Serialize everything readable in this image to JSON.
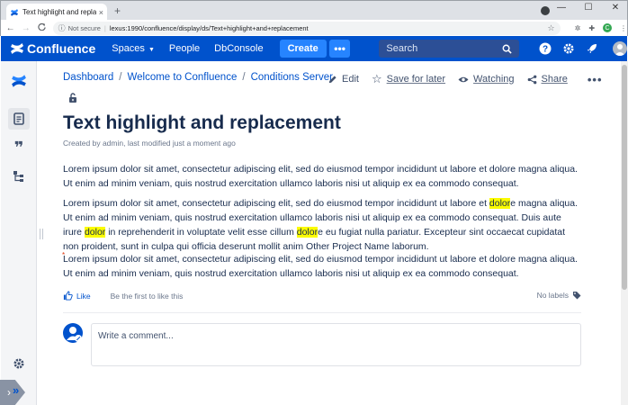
{
  "browser": {
    "tab_title": "Text highlight and replacement",
    "tab_close": "×",
    "new_tab": "+",
    "back": "←",
    "forward": "→",
    "reload": "C",
    "security": "Not secure",
    "url": "lexus:1990/confluence/display/ds/Text+highlight+and+replacement",
    "minimize": "—",
    "maximize": "☐",
    "close": "✕",
    "profile_initial": "C"
  },
  "header": {
    "brand": "Confluence",
    "nav": {
      "spaces": "Spaces",
      "people": "People",
      "dbconsole": "DbConsole"
    },
    "create_label": "Create",
    "more_label": "•••",
    "search_placeholder": "Search",
    "colors": {
      "bar": "#0052cc",
      "create": "#2684ff"
    }
  },
  "breadcrumbs": [
    "Dashboard",
    "Welcome to Confluence",
    "Conditions Server"
  ],
  "breadcrumb_sep": "/",
  "actions": {
    "edit": "Edit",
    "save_for_later": "Save for later",
    "watching": "Watching",
    "share": "Share",
    "more": "•••"
  },
  "page": {
    "title": "Text highlight and replacement",
    "byline": "Created by admin, last modified just a moment ago",
    "para1": "Lorem ipsum dolor sit amet, consectetur adipiscing elit, sed do eiusmod tempor incididunt ut labore et dolore magna aliqua. Ut enim ad minim veniam, quis nostrud exercitation ullamco laboris nisi ut aliquip ex ea commodo consequat.",
    "para2": {
      "s1": "Lorem ipsum dolor sit amet, consectetur adipiscing elit, sed do eiusmod tempor incididunt ut labore et ",
      "h1": "dolor",
      "s2": "e magna aliqua. Ut enim ad minim veniam, quis nostrud exercitation ullamco laboris nisi ut aliquip ex ea commodo consequat. Duis aute irure ",
      "h2": "dolor",
      "s3": " in reprehenderit in voluptate velit esse cillum ",
      "h3": "dolor",
      "s4": "e eu fugiat nulla pariatur. Excepteur sint occaecat cupidatat non proident, sunt in culpa qui officia deserunt mollit anim Other Project Name laborum."
    },
    "marker": "*",
    "para3": "Lorem ipsum dolor sit amet, consectetur adipiscing elit, sed do eiusmod tempor incididunt ut labore et dolore magna aliqua. Ut enim ad minim veniam, quis nostrud exercitation ullamco laboris nisi ut aliquip ex ea commodo consequat.",
    "highlight_color": "#fbfb00"
  },
  "likes": {
    "like_label": "Like",
    "message": "Be the first to like this",
    "labels": "No labels"
  },
  "comment": {
    "placeholder": "Write a comment..."
  }
}
